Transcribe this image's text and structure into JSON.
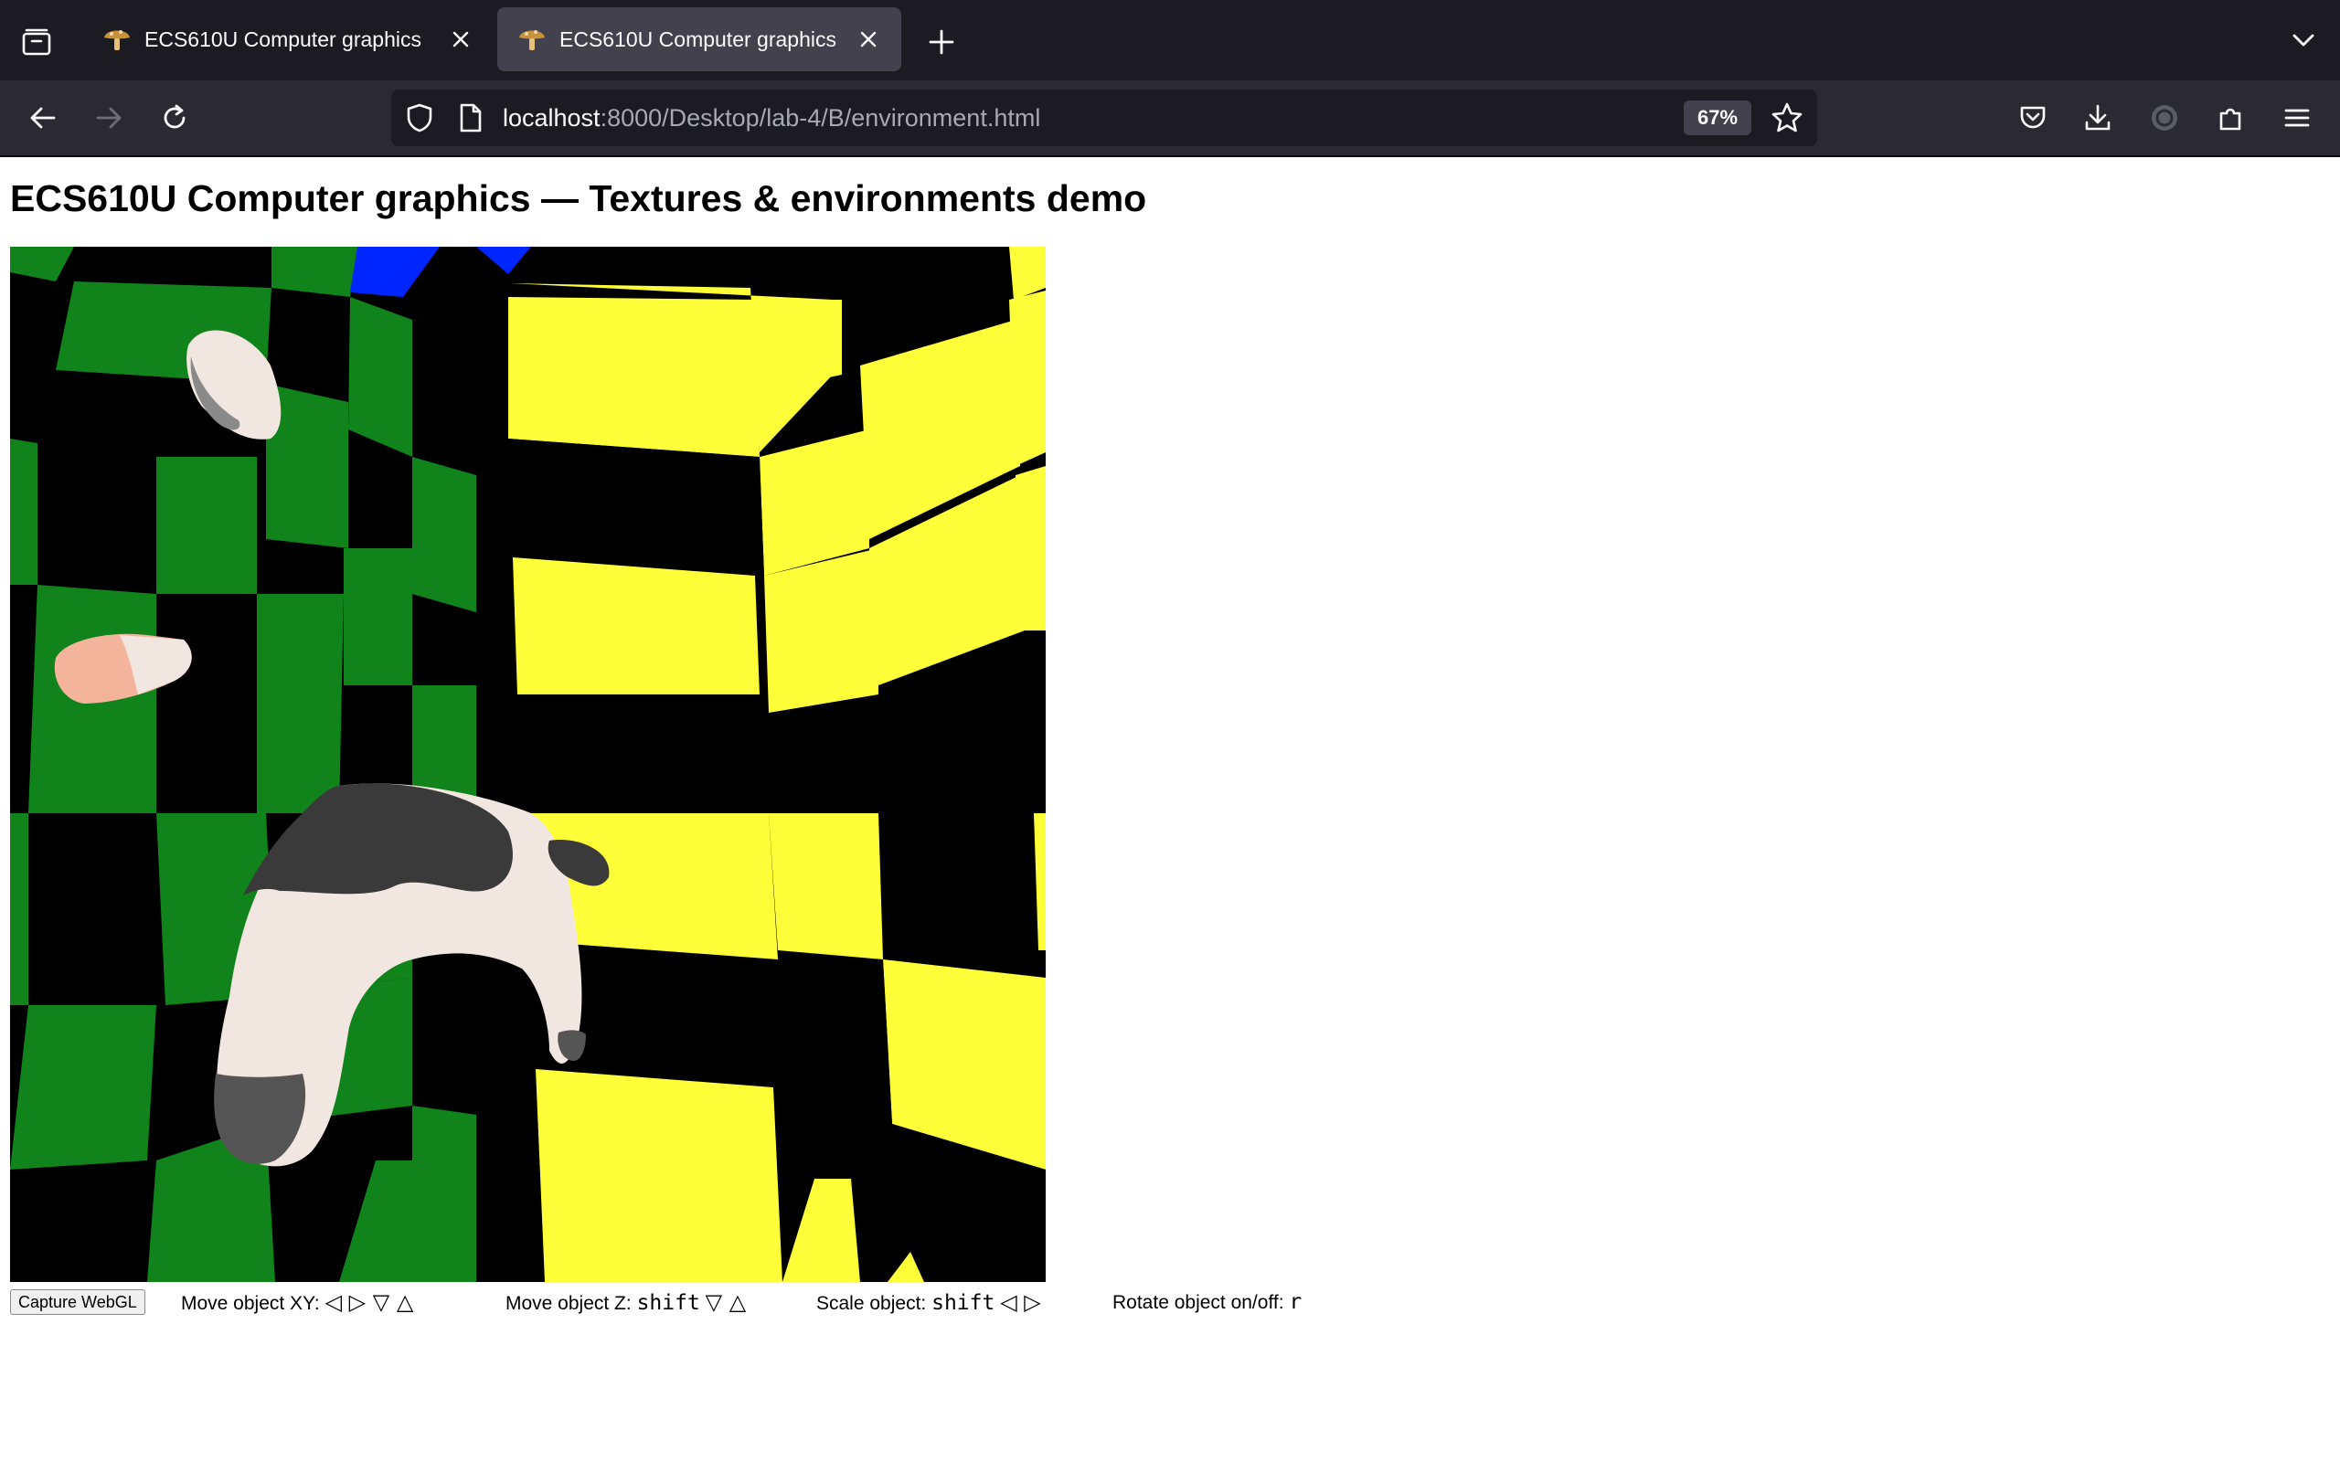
{
  "browser": {
    "tabs": [
      {
        "title": "ECS610U Computer graphics",
        "active": false
      },
      {
        "title": "ECS610U Computer graphics",
        "active": true
      }
    ],
    "url": {
      "host": "localhost",
      "rest": ":8000/Desktop/lab-4/B/environment.html"
    },
    "zoom": "67%",
    "colors": {
      "tabbar": "#1c1b22",
      "navbar": "#2b2a33",
      "active_tab": "#42414d"
    }
  },
  "page": {
    "title": "ECS610U Computer graphics — Textures & environments demo",
    "capture_button": "Capture WebGL",
    "controls": {
      "move_xy_label": "Move object XY:",
      "move_xy_keys": "◁ ▷ ▽ △",
      "move_z_label": "Move object Z:",
      "move_z_mod": "shift",
      "move_z_keys": "▽ △",
      "scale_label": "Scale object:",
      "scale_mod": "shift",
      "scale_keys": "◁ ▷",
      "rotate_label": "Rotate object on/off:",
      "rotate_key": "r"
    },
    "scene_colors": {
      "green": "#10831b",
      "yellow": "#ffff39",
      "blue": "#0026ff",
      "black": "#000000",
      "cow_white": "#f1e7e0"
    }
  }
}
